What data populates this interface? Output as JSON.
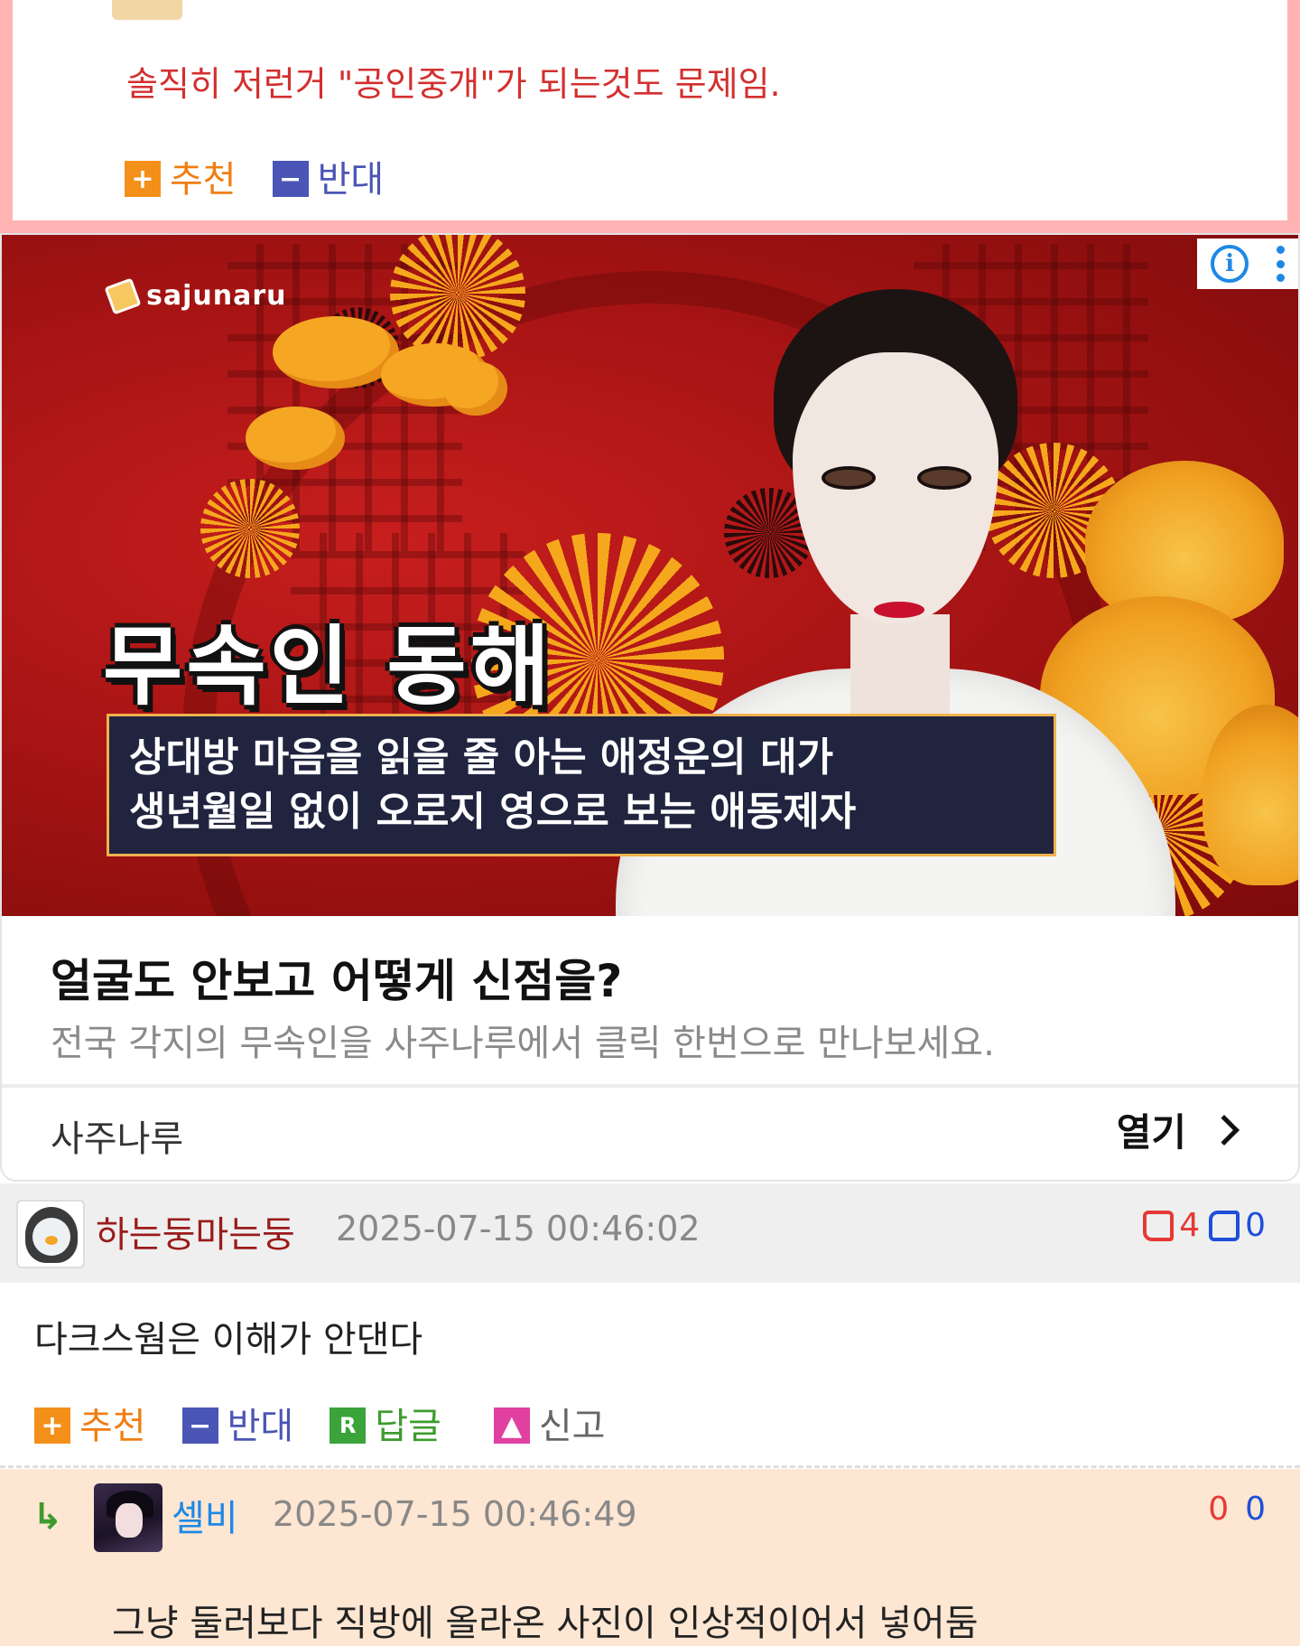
{
  "top_comment": {
    "text": "솔직히 저런거 \"공인중개\"가 되는것도 문제임.",
    "upvote_label": "추천",
    "downvote_label": "반대"
  },
  "ad": {
    "brand_logo": "sajunaru",
    "headline": "무속인 동해",
    "subline_1": "상대방 마음을 읽을 줄 아는 애정운의 대가",
    "subline_2": "생년월일 없이 오로지 영으로 보는 애동제자",
    "title": "얼굴도 안보고 어떻게 신점을?",
    "description": "전국 각지의 무속인을 사주나루에서 클릭 한번으로 만나보세요.",
    "advertiser": "사주나루",
    "open_label": "열기",
    "info_icon": "i",
    "colors": {
      "bg_red": "#a81414",
      "gold": "#f6a81c",
      "navy_box": "#20243f"
    }
  },
  "comments": [
    {
      "author": "하는둥마는둥",
      "timestamp": "2025-07-15 00:46:02",
      "upvotes": "4",
      "downvotes": "0",
      "text": "다크스웜은 이해가 안댄다",
      "actions": {
        "up": "추천",
        "down": "반대",
        "reply": "답글",
        "report": "신고"
      },
      "avatar_icon": "penguin-avatar"
    },
    {
      "author": "셀비",
      "timestamp": "2025-07-15 00:46:49",
      "upvotes": "0",
      "downvotes": "0",
      "text": "그냥 둘러보다 직방에 올라온 사진이 인상적이어서 넣어둠",
      "avatar_icon": "anime-avatar",
      "is_reply": true
    }
  ]
}
